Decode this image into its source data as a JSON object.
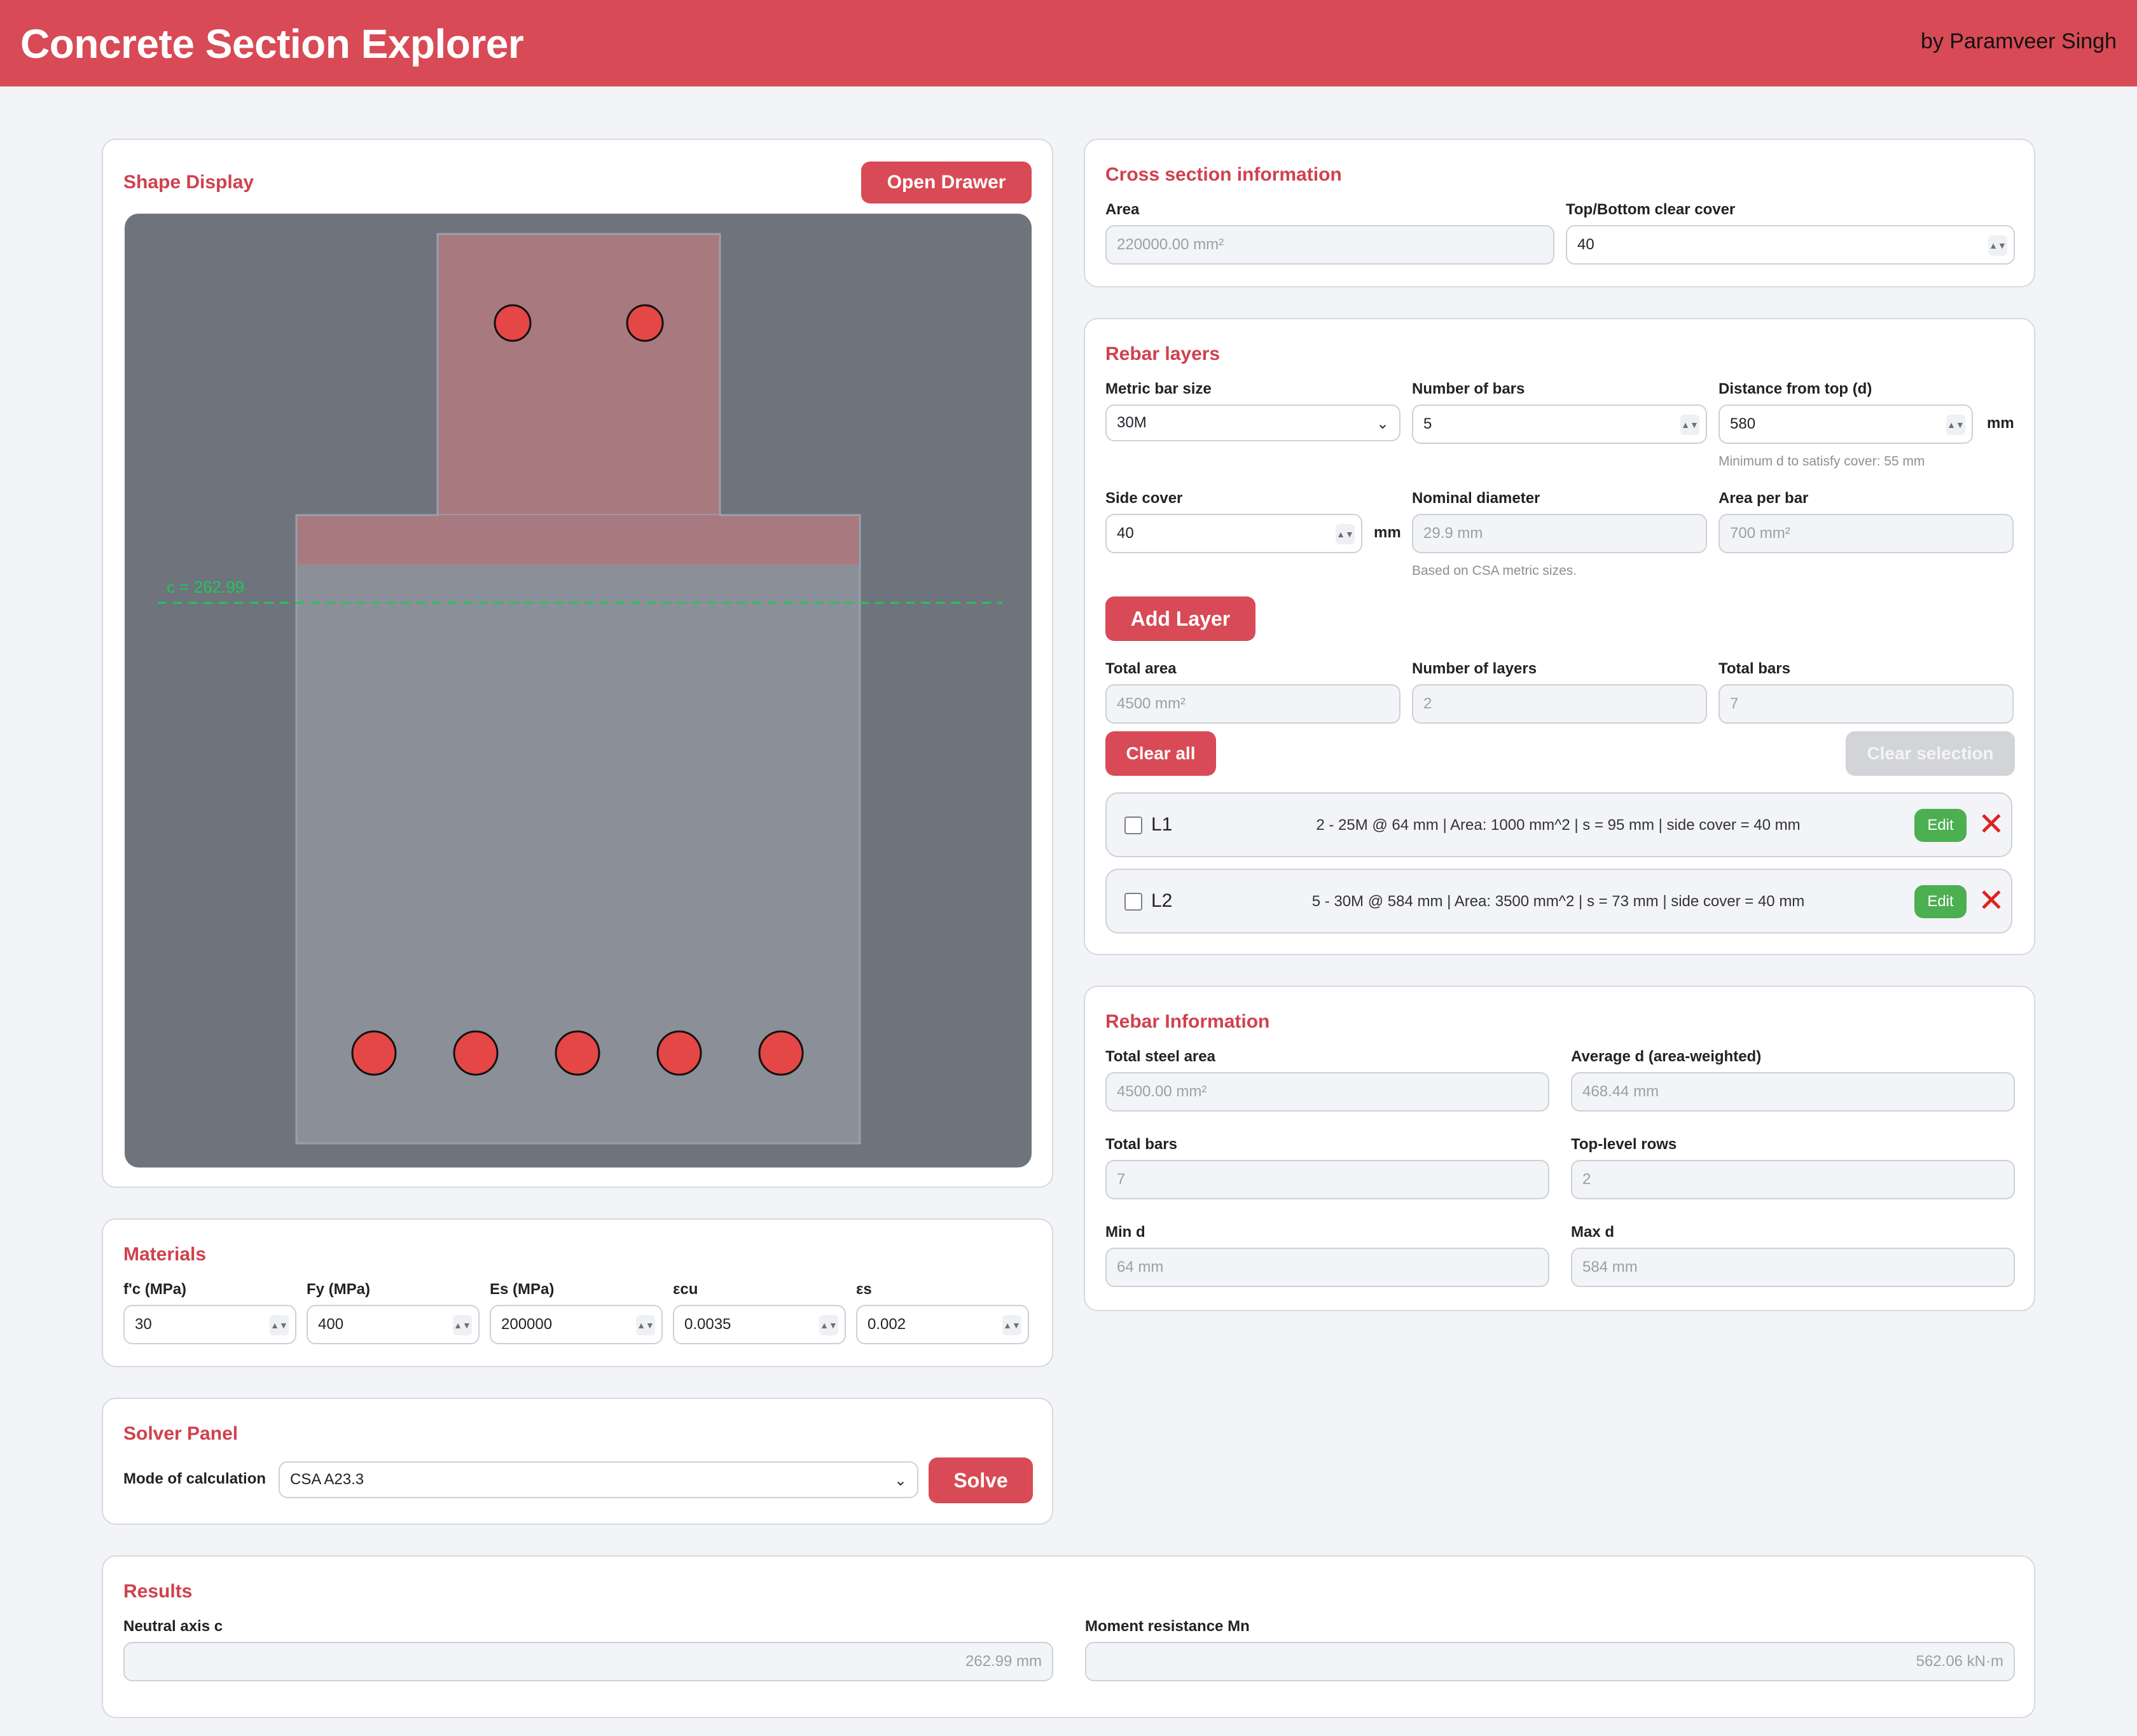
{
  "header": {
    "title": "Concrete Section Explorer",
    "byline": "by Paramveer Singh"
  },
  "shape_display": {
    "title": "Shape Display",
    "open_drawer_label": "Open Drawer",
    "neutral_axis_label": "c = 262.99"
  },
  "cross_section": {
    "title": "Cross section information",
    "area_label": "Area",
    "area_value": "220000.00 mm²",
    "cover_label": "Top/Bottom clear cover",
    "cover_value": "40"
  },
  "rebar_layers": {
    "title": "Rebar layers",
    "bar_size_label": "Metric bar size",
    "bar_size_value": "30M",
    "num_bars_label": "Number of bars",
    "num_bars_value": "5",
    "distance_label": "Distance from top (d)",
    "distance_value": "580",
    "distance_unit": "mm",
    "min_d_hint": "Minimum d to satisfy cover: 55 mm",
    "side_cover_label": "Side cover",
    "side_cover_value": "40",
    "side_cover_unit": "mm",
    "nominal_diameter_label": "Nominal diameter",
    "nominal_diameter_value": "29.9 mm",
    "nominal_hint": "Based on CSA metric sizes.",
    "area_per_bar_label": "Area per bar",
    "area_per_bar_value": "700 mm²",
    "add_layer_label": "Add Layer",
    "total_area_label": "Total area",
    "total_area_value": "4500 mm²",
    "num_layers_label": "Number of layers",
    "num_layers_value": "2",
    "total_bars_label": "Total bars",
    "total_bars_value": "7",
    "clear_all_label": "Clear all",
    "clear_selection_label": "Clear selection",
    "layers": [
      {
        "name": "L1",
        "desc": "2 - 25M @ 64 mm | Area: 1000 mm^2 | s = 95 mm | side cover = 40 mm",
        "edit": "Edit",
        "delete": "✕"
      },
      {
        "name": "L2",
        "desc": "5 - 30M @ 584 mm | Area: 3500 mm^2 | s = 73 mm | side cover = 40 mm",
        "edit": "Edit",
        "delete": "✕"
      }
    ]
  },
  "rebar_info": {
    "title": "Rebar Information",
    "total_steel_label": "Total steel area",
    "total_steel_value": "4500.00 mm²",
    "avg_d_label": "Average d (area-weighted)",
    "avg_d_value": "468.44 mm",
    "total_bars_label": "Total bars",
    "total_bars_value": "7",
    "top_rows_label": "Top-level rows",
    "top_rows_value": "2",
    "min_d_label": "Min d",
    "min_d_value": "64 mm",
    "max_d_label": "Max d",
    "max_d_value": "584 mm"
  },
  "materials": {
    "title": "Materials",
    "fc_label": "f'c (MPa)",
    "fc_value": "30",
    "fy_label": "Fy (MPa)",
    "fy_value": "400",
    "es_label": "Es (MPa)",
    "es_value": "200000",
    "ecu_label": "εcu",
    "ecu_value": "0.0035",
    "eps_label": "εs",
    "eps_value": "0.002"
  },
  "solver": {
    "title": "Solver Panel",
    "mode_label": "Mode of calculation",
    "mode_value": "CSA A23.3",
    "solve_label": "Solve"
  },
  "results": {
    "title": "Results",
    "neutral_axis_label": "Neutral axis c",
    "neutral_axis_value": "262.99 mm",
    "moment_label": "Moment resistance Mn",
    "moment_value": "562.06 kN·m"
  },
  "colors": {
    "accent": "#d84a55",
    "canvas_bg": "#6e737c",
    "compression_zone": "#a87a80",
    "section_fill": "#8b8f98",
    "rebar": "#e54646",
    "neutral_axis": "#22c55e",
    "edit_green": "#4caf50"
  },
  "icons": [
    "spinner-icon",
    "chevron-down-icon",
    "delete-x-icon",
    "checkbox-icon"
  ]
}
